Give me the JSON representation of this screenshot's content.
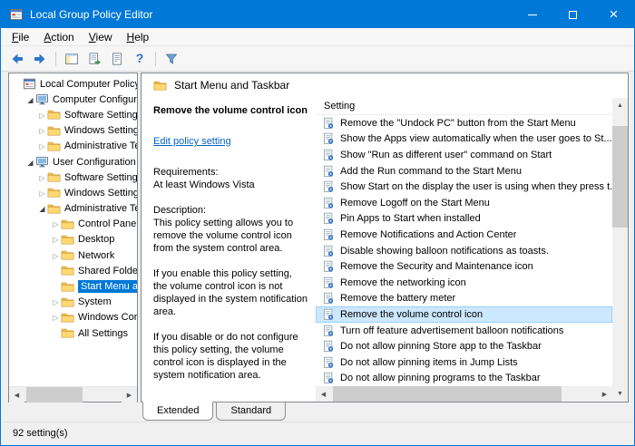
{
  "window": {
    "title": "Local Group Policy Editor"
  },
  "menu": {
    "items": [
      "File",
      "Action",
      "View",
      "Help"
    ]
  },
  "toolbar": {
    "icons": [
      "back",
      "forward",
      "show-console-tree",
      "export-list",
      "properties",
      "help",
      "filter"
    ]
  },
  "tree": {
    "items": [
      {
        "label": "Local Computer Policy",
        "level": 0,
        "icon": "console",
        "expander": "none",
        "selected": false
      },
      {
        "label": "Computer Configuration",
        "level": 1,
        "icon": "computer",
        "expander": "expanded",
        "selected": false
      },
      {
        "label": "Software Settings",
        "level": 2,
        "icon": "folder",
        "expander": "collapsed",
        "selected": false
      },
      {
        "label": "Windows Settings",
        "level": 2,
        "icon": "folder",
        "expander": "collapsed",
        "selected": false
      },
      {
        "label": "Administrative Templates",
        "level": 2,
        "icon": "folder",
        "expander": "collapsed",
        "selected": false
      },
      {
        "label": "User Configuration",
        "level": 1,
        "icon": "computer",
        "expander": "expanded",
        "selected": false
      },
      {
        "label": "Software Settings",
        "level": 2,
        "icon": "folder",
        "expander": "collapsed",
        "selected": false
      },
      {
        "label": "Windows Settings",
        "level": 2,
        "icon": "folder",
        "expander": "collapsed",
        "selected": false
      },
      {
        "label": "Administrative Templates",
        "level": 2,
        "icon": "folder",
        "expander": "expanded",
        "selected": false
      },
      {
        "label": "Control Panel",
        "level": 3,
        "icon": "folder",
        "expander": "collapsed",
        "selected": false
      },
      {
        "label": "Desktop",
        "level": 3,
        "icon": "folder",
        "expander": "collapsed",
        "selected": false
      },
      {
        "label": "Network",
        "level": 3,
        "icon": "folder",
        "expander": "collapsed",
        "selected": false
      },
      {
        "label": "Shared Folders",
        "level": 3,
        "icon": "folder",
        "expander": "none",
        "selected": false
      },
      {
        "label": "Start Menu and Taskbar",
        "level": 3,
        "icon": "folder",
        "expander": "none",
        "selected": true
      },
      {
        "label": "System",
        "level": 3,
        "icon": "folder",
        "expander": "collapsed",
        "selected": false
      },
      {
        "label": "Windows Components",
        "level": 3,
        "icon": "folder",
        "expander": "collapsed",
        "selected": false
      },
      {
        "label": "All Settings",
        "level": 3,
        "icon": "folder",
        "expander": "none",
        "selected": false
      }
    ]
  },
  "content": {
    "header": {
      "title": "Start Menu and Taskbar"
    },
    "detail": {
      "policy_title": "Remove the volume control icon",
      "edit_link": "Edit policy setting",
      "requirements_label": "Requirements:",
      "requirements_value": "At least Windows Vista",
      "description_label": "Description:",
      "paragraph1": "This policy setting allows you to remove the volume control icon from the system control area.",
      "paragraph2": "If you enable this policy setting, the volume control icon is not displayed in the system notification area.",
      "paragraph3": "If you disable or do not configure this policy setting, the volume control icon is displayed in the system notification area."
    },
    "list": {
      "column_header": "Setting",
      "selected_index": 12,
      "items": [
        "Remove the \"Undock PC\" button from the Start Menu",
        "Show the Apps view automatically when the user goes to St...",
        "Show \"Run as different user\" command on Start",
        "Add the Run command to the Start Menu",
        "Show Start on the display the user is using when they press t...",
        "Remove Logoff on the Start Menu",
        "Pin Apps to Start when installed",
        "Remove Notifications and Action Center",
        "Disable showing balloon notifications as toasts.",
        "Remove the Security and Maintenance icon",
        "Remove the networking icon",
        "Remove the battery meter",
        "Remove the volume control icon",
        "Turn off feature advertisement balloon notifications",
        "Do not allow pinning Store app to the Taskbar",
        "Do not allow pinning items in Jump Lists",
        "Do not allow pinning programs to the Taskbar"
      ]
    }
  },
  "tabs": {
    "items": [
      {
        "label": "Extended",
        "active": true
      },
      {
        "label": "Standard",
        "active": false
      }
    ]
  },
  "status": {
    "text": "92 setting(s)"
  },
  "colors": {
    "titlebar": "#0078d7",
    "tree_selection": "#0078d7",
    "list_selection": "#cce8ff",
    "list_selection_border": "#99d1ff",
    "link": "#0563c1"
  }
}
